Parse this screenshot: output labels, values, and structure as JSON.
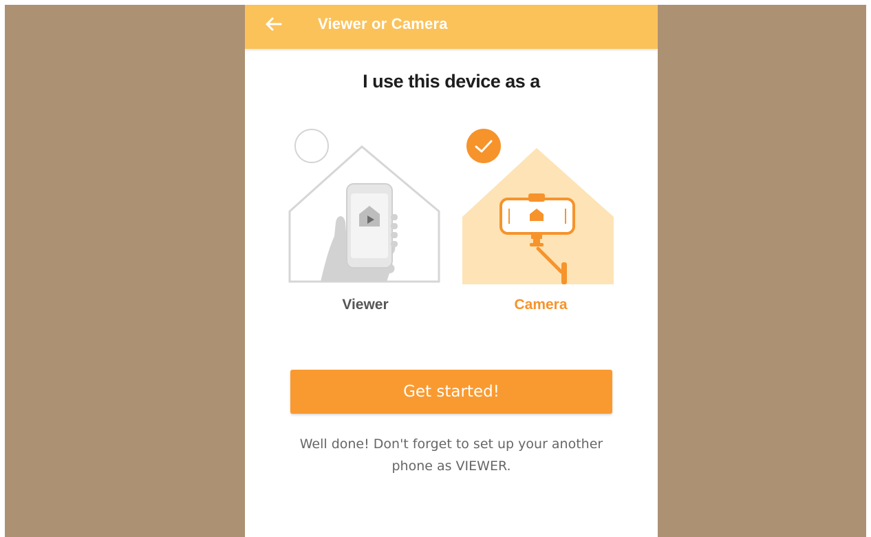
{
  "appbar": {
    "title": "Viewer or Camera",
    "back_icon": "arrow-left-icon",
    "background_color": "#fbc25a"
  },
  "heading": "I use this device as a",
  "options": [
    {
      "label": "Viewer",
      "selected": false,
      "icon": "phone-in-hand-icon"
    },
    {
      "label": "Camera",
      "selected": true,
      "icon": "phone-on-tripod-icon"
    }
  ],
  "cta": {
    "label": "Get started!",
    "color": "#f99a30"
  },
  "hint": {
    "line1": "Well done! Don't forget to set up your another",
    "line2": "phone as VIEWER."
  },
  "colors": {
    "accent": "#f6932b",
    "backdrop": "#ac9173",
    "camera_house_fill": "#fde3b5"
  }
}
